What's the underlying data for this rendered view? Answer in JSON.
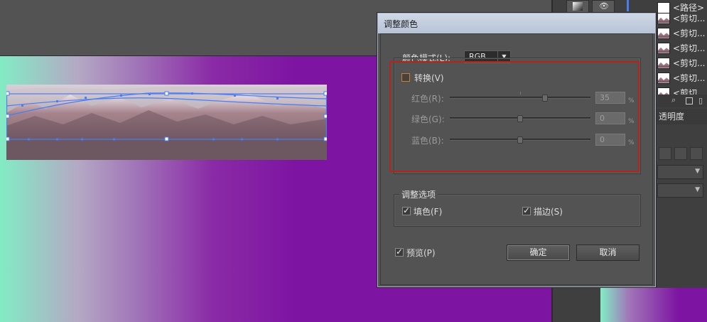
{
  "dialog": {
    "title": "调整颜色",
    "color_mode_label": "颜色模式(L):",
    "color_mode_value": "RGB",
    "convert_label": "转换(V)",
    "convert_checked": false,
    "channels": [
      {
        "label": "红色(R):",
        "value": "35",
        "unit": "%",
        "level": 0.35
      },
      {
        "label": "绿色(G):",
        "value": "0",
        "unit": "%",
        "level": 0.0
      },
      {
        "label": "蓝色(B):",
        "value": "0",
        "unit": "%",
        "level": 0.0
      }
    ],
    "adjust_options_label": "调整选项",
    "fill_label": "填色(F)",
    "fill_checked": true,
    "stroke_label": "描边(S)",
    "stroke_checked": true,
    "preview_label": "预览(P)",
    "preview_checked": true,
    "ok_label": "确定",
    "cancel_label": "取消"
  },
  "layers_panel": {
    "items": [
      {
        "label": "<路径>",
        "thumb": "white"
      },
      {
        "label": "<剪切...",
        "thumb": "mountain"
      },
      {
        "label": "<剪切...",
        "thumb": "mountain"
      },
      {
        "label": "<剪切...",
        "thumb": "mountain"
      },
      {
        "label": "<剪切...",
        "thumb": "mountain"
      },
      {
        "label": "<剪切...",
        "thumb": "mountain"
      },
      {
        "label": "<剪切...",
        "thumb": "mountain"
      }
    ],
    "transparency_tab": "透明度"
  },
  "colors": {
    "highlight": "#b5231d",
    "selection": "#4a7cf2",
    "artboard_purple": "#7d14a2",
    "artboard_mint": "#82ecc4"
  }
}
